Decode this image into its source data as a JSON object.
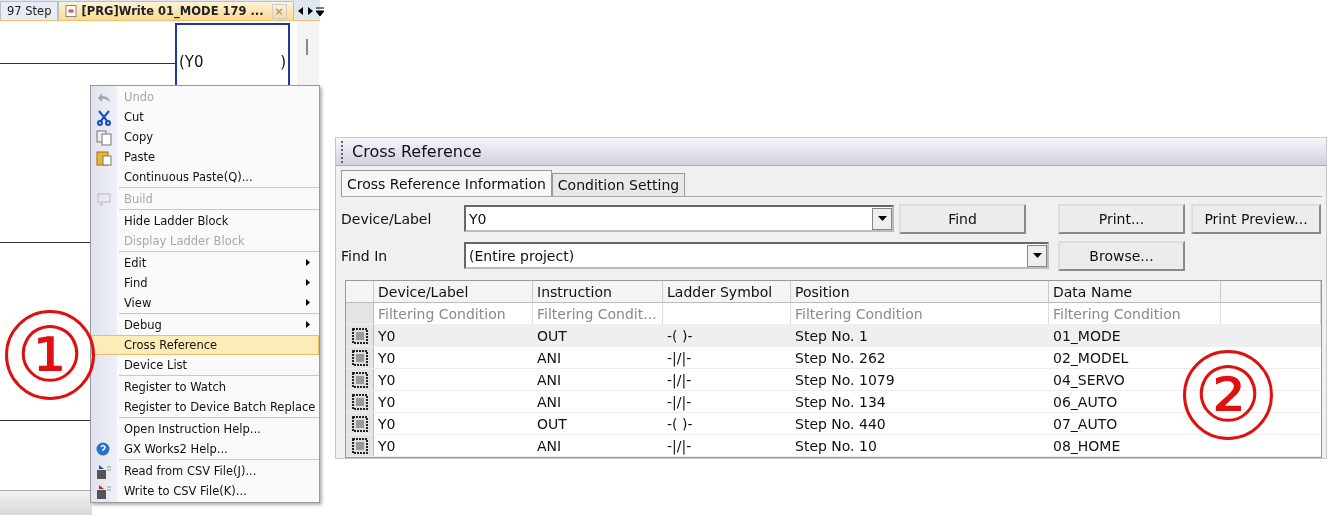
{
  "editor": {
    "tabs": [
      {
        "label": "97 Step",
        "selected": false
      },
      {
        "label": "[PRG]Write 01_MODE 179 ...",
        "selected": true,
        "close": "×"
      }
    ],
    "coil": {
      "open": "(",
      "device": "Y0",
      "close": ")",
      "selected": true
    }
  },
  "context_menu": {
    "items": [
      {
        "label": "Undo",
        "disabled": true,
        "submenu": false,
        "selected": false
      },
      {
        "label": "Cut",
        "disabled": false,
        "submenu": false,
        "selected": false
      },
      {
        "label": "Copy",
        "disabled": false,
        "submenu": false,
        "selected": false
      },
      {
        "label": "Paste",
        "disabled": false,
        "submenu": false,
        "selected": false
      },
      {
        "label": "Continuous Paste(Q)...",
        "disabled": false,
        "submenu": false,
        "selected": false,
        "separator_after": true
      },
      {
        "label": "Build",
        "disabled": true,
        "submenu": false,
        "selected": false,
        "separator_after": true
      },
      {
        "label": "Hide Ladder Block",
        "disabled": false,
        "submenu": false,
        "selected": false
      },
      {
        "label": "Display Ladder Block",
        "disabled": true,
        "submenu": false,
        "selected": false,
        "separator_after": true
      },
      {
        "label": "Edit",
        "disabled": false,
        "submenu": true,
        "selected": false
      },
      {
        "label": "Find",
        "disabled": false,
        "submenu": true,
        "selected": false
      },
      {
        "label": "View",
        "disabled": false,
        "submenu": true,
        "selected": false,
        "separator_after": true
      },
      {
        "label": "Debug",
        "disabled": false,
        "submenu": true,
        "selected": false
      },
      {
        "label": "Cross Reference",
        "disabled": false,
        "submenu": false,
        "selected": true
      },
      {
        "label": "Device List",
        "disabled": false,
        "submenu": false,
        "selected": false,
        "separator_after": true
      },
      {
        "label": "Register to Watch",
        "disabled": false,
        "submenu": false,
        "selected": false
      },
      {
        "label": "Register to Device Batch Replace",
        "disabled": false,
        "submenu": false,
        "selected": false,
        "separator_after": true
      },
      {
        "label": "Open Instruction Help...",
        "disabled": false,
        "submenu": false,
        "selected": false
      },
      {
        "label": "GX Works2 Help...",
        "disabled": false,
        "submenu": false,
        "selected": false,
        "separator_after": true
      },
      {
        "label": "Read from CSV File(J)...",
        "disabled": false,
        "submenu": false,
        "selected": false
      },
      {
        "label": "Write to CSV File(K)...",
        "disabled": false,
        "submenu": false,
        "selected": false
      }
    ]
  },
  "annotations": [
    {
      "label": "①"
    },
    {
      "label": "②"
    }
  ],
  "cross_reference": {
    "title": "Cross Reference",
    "tabs": [
      {
        "label": "Cross Reference Information",
        "selected": true
      },
      {
        "label": "Condition Setting",
        "selected": false
      }
    ],
    "device_label": {
      "label": "Device/Label",
      "value": "Y0"
    },
    "find_in": {
      "label": "Find In",
      "value": "(Entire project)"
    },
    "buttons": {
      "find": "Find",
      "print": "Print...",
      "print_preview": "Print Preview...",
      "browse": "Browse..."
    },
    "table": {
      "columns": [
        {
          "label": "Device/Label",
          "filter": "Filtering Condition"
        },
        {
          "label": "Instruction",
          "filter": "Filtering Condit..."
        },
        {
          "label": "Ladder Symbol"
        },
        {
          "label": "Position",
          "filter": "Filtering Condition"
        },
        {
          "label": "Data Name",
          "filter": "Filtering Condition"
        }
      ],
      "rows": [
        {
          "cells": [
            "Y0",
            "OUT",
            "-( )-",
            "Step No. 1",
            "01_MODE"
          ],
          "selected": true
        },
        {
          "cells": [
            "Y0",
            "ANI",
            "-|/|-",
            "Step No. 262",
            "02_MODEL"
          ],
          "selected": false
        },
        {
          "cells": [
            "Y0",
            "ANI",
            "-|/|-",
            "Step No. 1079",
            "04_SERVO"
          ],
          "selected": false
        },
        {
          "cells": [
            "Y0",
            "ANI",
            "-|/|-",
            "Step No. 134",
            "06_AUTO"
          ],
          "selected": false
        },
        {
          "cells": [
            "Y0",
            "OUT",
            "-( )-",
            "Step No. 440",
            "07_AUTO"
          ],
          "selected": false
        },
        {
          "cells": [
            "Y0",
            "ANI",
            "-|/|-",
            "Step No. 10",
            "08_HOME"
          ],
          "selected": false
        }
      ]
    }
  }
}
